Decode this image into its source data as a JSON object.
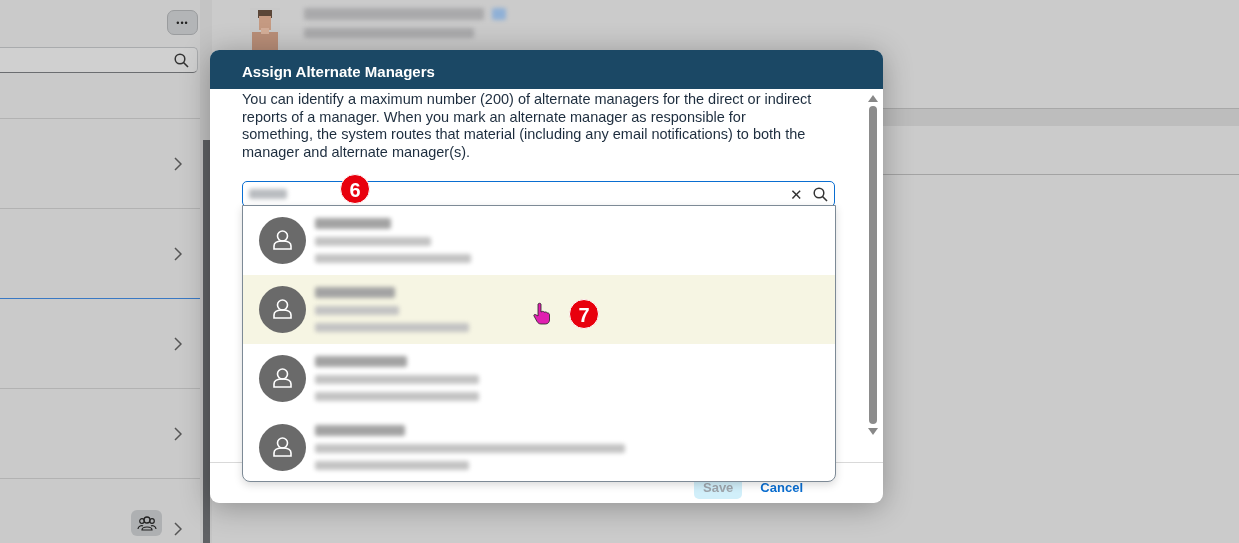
{
  "dialog": {
    "title": "Assign Alternate Managers",
    "description": "You can identify a maximum number (200) of alternate managers for the direct or indirect reports of a manager. When you mark an alternate manager as responsible for something, the system routes that material (including any email notifications) to both the manager and alternate manager(s).",
    "search": {
      "clear_label": "✕"
    },
    "results": [
      {
        "hovered": false
      },
      {
        "hovered": true
      },
      {
        "hovered": false
      },
      {
        "hovered": false
      }
    ],
    "buttons": [
      {
        "label": "Save",
        "kind": "primary",
        "disabled": true
      },
      {
        "label": "Cancel",
        "kind": "link",
        "disabled": false
      }
    ]
  },
  "callouts": [
    {
      "label": "6"
    },
    {
      "label": "7"
    }
  ],
  "background": {
    "more_label": "•••"
  }
}
